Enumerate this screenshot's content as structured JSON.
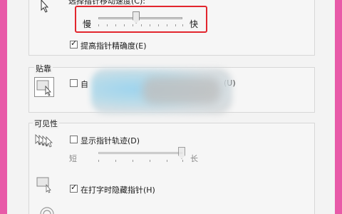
{
  "speed": {
    "title_partial": "选择指针移动速度(C):",
    "slow_label": "慢",
    "fast_label": "快",
    "slider_value": 0.45
  },
  "precision_checkbox": {
    "label": "提高指针精确度(E)",
    "checked": true
  },
  "snap_group": {
    "title": "贴靠",
    "checkbox_label_start": "自",
    "checkbox_label_end": "(U)",
    "checked": false
  },
  "visibility_group": {
    "title": "可见性",
    "trails_checkbox": {
      "label": "显示指针轨迹(D)",
      "checked": false
    },
    "short_label": "短",
    "long_label": "长",
    "trail_slider_value": 1.0,
    "hide_typing_checkbox": {
      "label": "在打字时隐藏指针(H)",
      "checked": true
    }
  },
  "colors": {
    "accent_highlight": "#e2262e",
    "frame": "#e85aa8"
  }
}
